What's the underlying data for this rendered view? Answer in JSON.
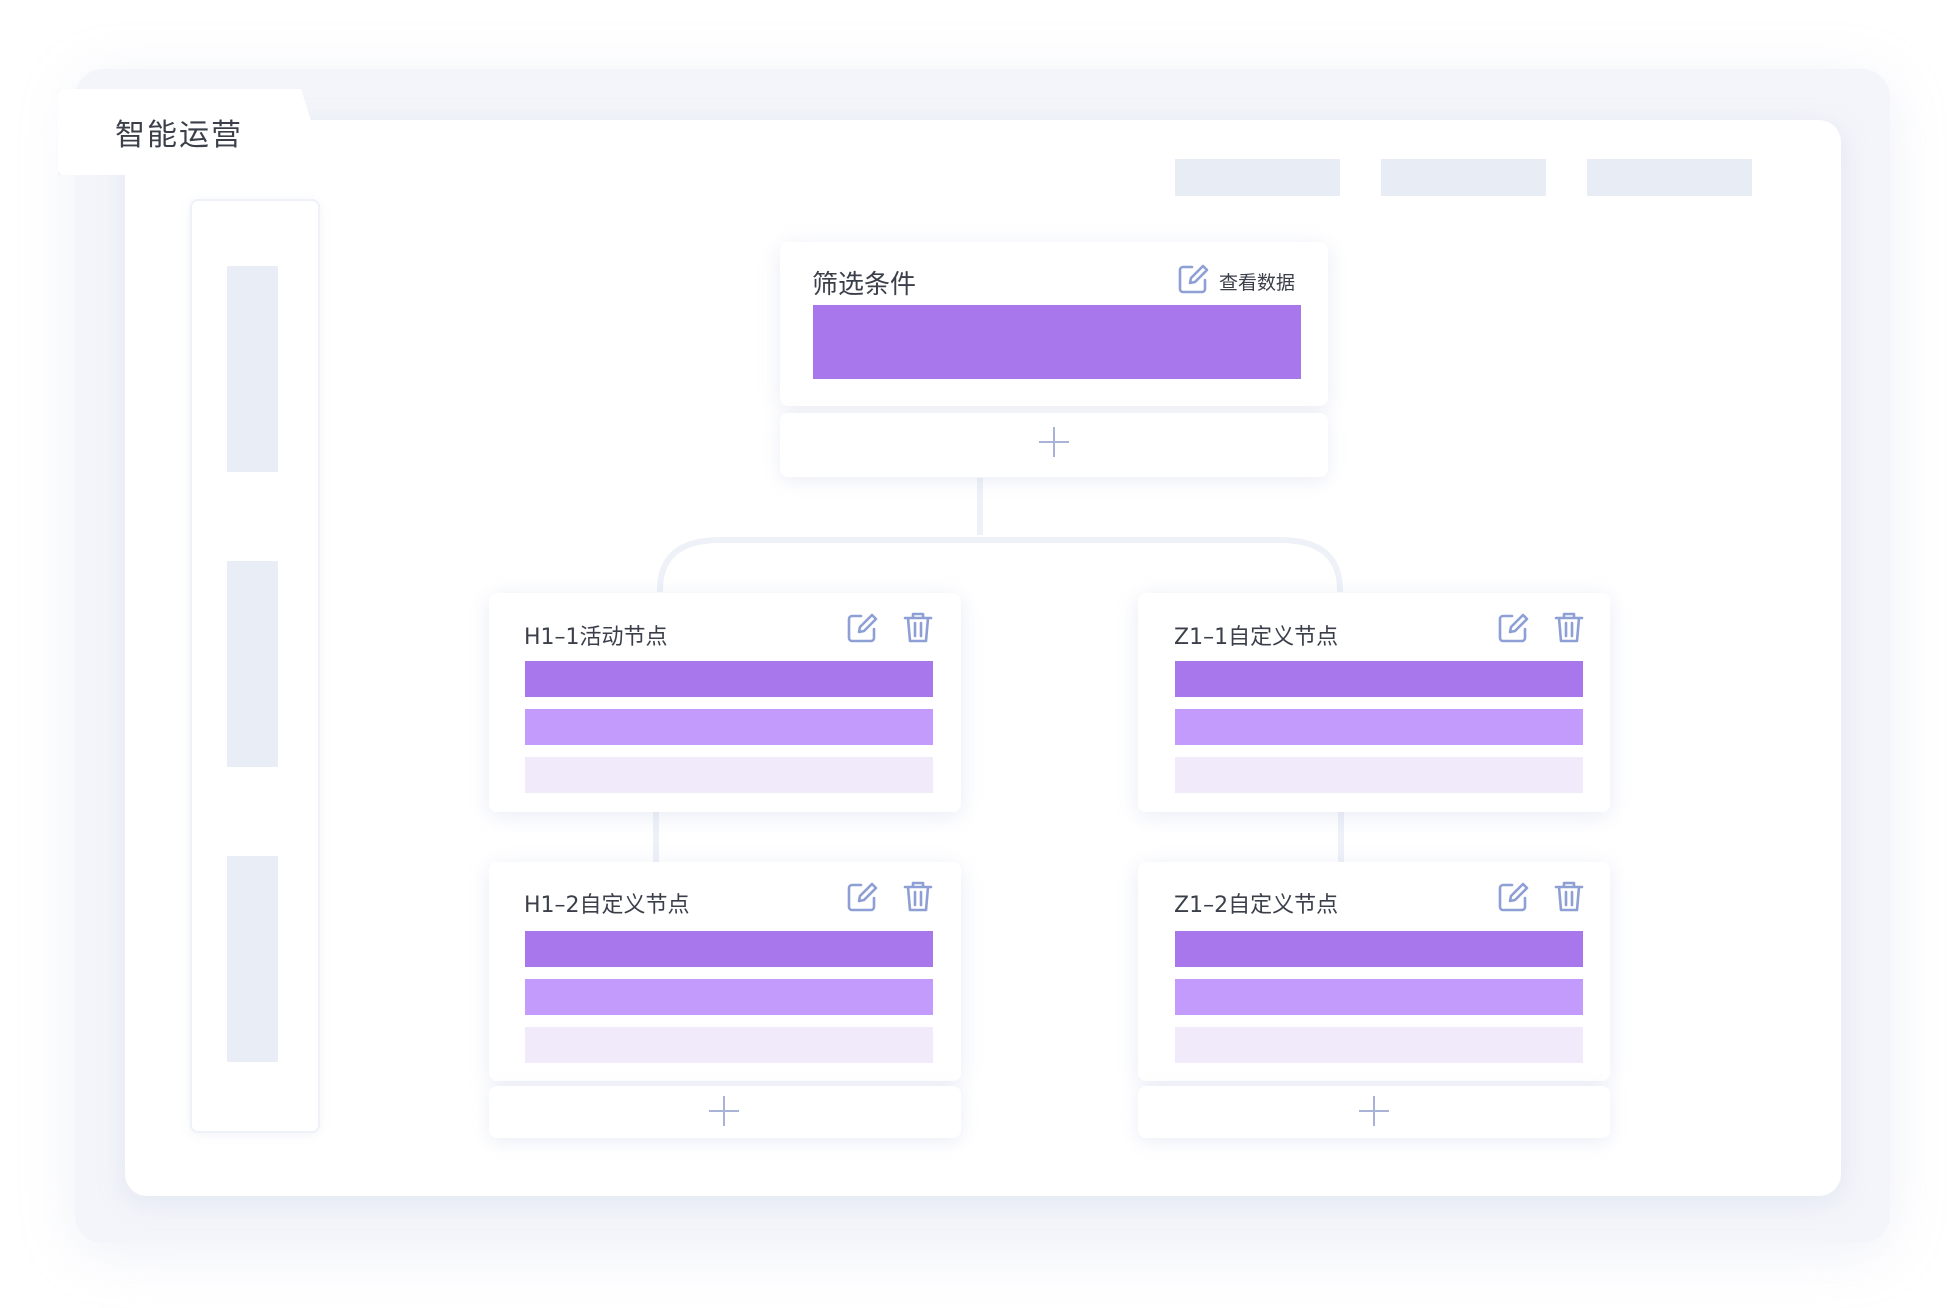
{
  "app": {
    "title": "智能运营"
  },
  "root_node": {
    "title": "筛选条件",
    "view_data_label": "查看数据",
    "edit_icon": "edit-icon",
    "add_icon": "plus-icon"
  },
  "branches": [
    {
      "nodes": [
        {
          "title": "H1–1活动节点",
          "edit_icon": "edit-icon",
          "delete_icon": "trash-icon"
        },
        {
          "title": "H1–2自定义节点",
          "edit_icon": "edit-icon",
          "delete_icon": "trash-icon"
        }
      ],
      "add_icon": "plus-icon"
    },
    {
      "nodes": [
        {
          "title": "Z1–1自定义节点",
          "edit_icon": "edit-icon",
          "delete_icon": "trash-icon"
        },
        {
          "title": "Z1–2自定义节点",
          "edit_icon": "edit-icon",
          "delete_icon": "trash-icon"
        }
      ],
      "add_icon": "plus-icon"
    }
  ],
  "colors": {
    "bar_primary": "#a877ec",
    "bar_secondary": "#c39bfd",
    "bar_tertiary": "#f1eafb",
    "icon": "#8e9fd6",
    "placeholder": "#e9edf5"
  }
}
